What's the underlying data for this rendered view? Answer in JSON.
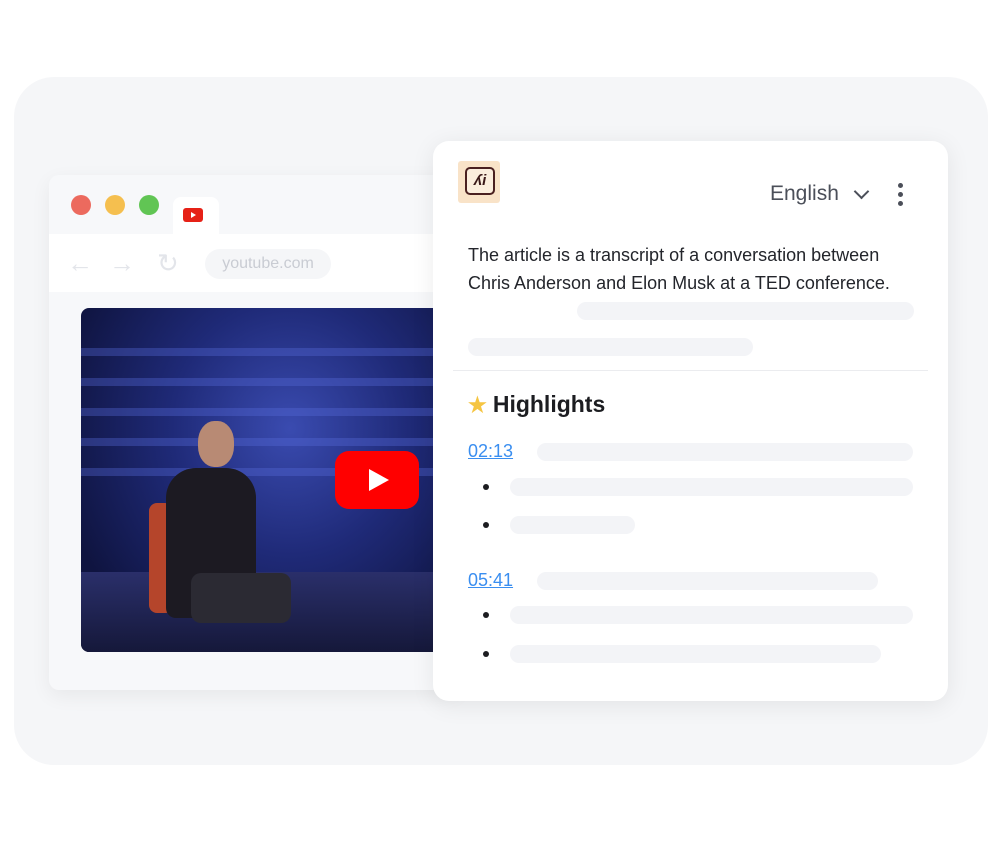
{
  "browser": {
    "url": "youtube.com",
    "tab_icon": "youtube-icon",
    "window_controls": [
      "#ec6a5e",
      "#f5bf4f",
      "#61c554"
    ]
  },
  "video": {
    "play_icon": "play-icon",
    "play_color": "#ff0000"
  },
  "panel": {
    "language": "English",
    "summary": "The article is a transcript of a conversation between Chris Anderson and Elon Musk at a TED conference.",
    "highlights_title": "Highlights",
    "highlights": [
      {
        "timestamp": "02:13"
      },
      {
        "timestamp": "05:41"
      }
    ],
    "link_color": "#3a8ef0"
  }
}
